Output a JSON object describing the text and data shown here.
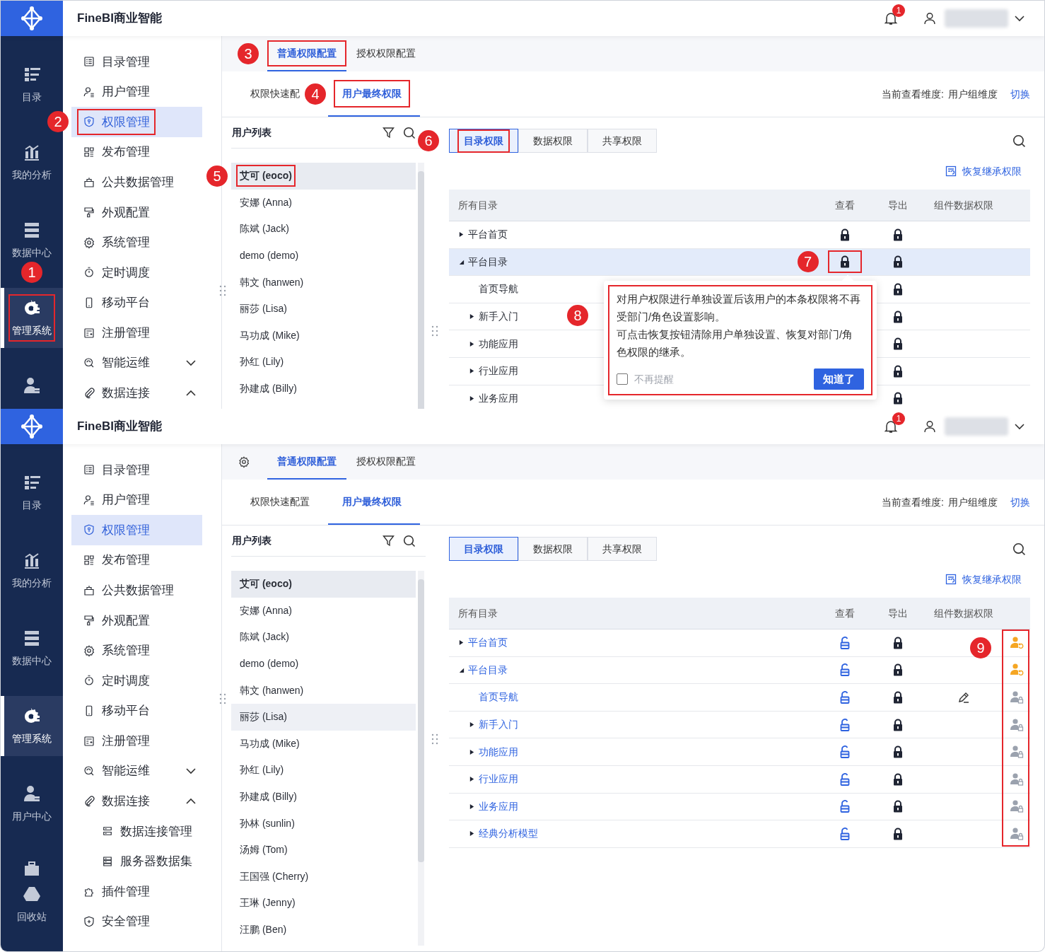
{
  "screens": [
    {
      "app_title": "FineBI商业智能",
      "notification_count": "1",
      "nav": [
        {
          "label": "目录",
          "selected": false
        },
        {
          "label": "我的分析",
          "selected": false
        },
        {
          "label": "数据中心",
          "selected": false
        },
        {
          "label": "管理系统",
          "selected": true,
          "outlined": true,
          "callout": "1"
        },
        {
          "selected": false
        }
      ],
      "menu": [
        {
          "label": "目录管理",
          "selected": false
        },
        {
          "label": "用户管理",
          "selected": false
        },
        {
          "label": "权限管理",
          "selected": true,
          "outlined": true,
          "callout": "2"
        },
        {
          "label": "发布管理",
          "selected": false
        },
        {
          "label": "公共数据管理",
          "selected": false
        },
        {
          "label": "外观配置",
          "selected": false
        },
        {
          "label": "系统管理",
          "selected": false
        },
        {
          "label": "定时调度",
          "selected": false
        },
        {
          "label": "移动平台",
          "selected": false
        },
        {
          "label": "注册管理",
          "selected": false
        },
        {
          "label": "智能运维",
          "selected": false,
          "expanded": false
        },
        {
          "label": "数据连接",
          "selected": false,
          "expanded": true
        }
      ],
      "settings_button": false,
      "top_tabs": [
        {
          "label": "普通权限配置",
          "selected": true,
          "outlined": true,
          "callout": "3"
        },
        {
          "label": "授权权限配置",
          "selected": false
        }
      ],
      "sub_tabs": [
        {
          "label": "权限快速配",
          "selected": false
        },
        {
          "label": "用户最终权限",
          "selected": true,
          "outlined": true,
          "callout": "4"
        }
      ],
      "dimension": {
        "label": "当前查看维度:",
        "value": "用户组维度",
        "link": "切换"
      },
      "user_list": {
        "title": "用户列表",
        "users": [
          {
            "name": "艾可 (eoco)",
            "selected": true,
            "hovered": false,
            "outlined": true,
            "callout": "5"
          },
          {
            "name": "安娜 (Anna)",
            "selected": false,
            "hovered": false
          },
          {
            "name": "陈斌 (Jack)",
            "selected": false,
            "hovered": false
          },
          {
            "name": "demo (demo)",
            "selected": false,
            "hovered": false
          },
          {
            "name": "韩文 (hanwen)",
            "selected": false,
            "hovered": false
          },
          {
            "name": "丽莎 (Lisa)",
            "selected": false,
            "hovered": false
          },
          {
            "name": "马功成 (Mike)",
            "selected": false,
            "hovered": false
          },
          {
            "name": "孙红 (Lily)",
            "selected": false,
            "hovered": false
          },
          {
            "name": "孙建成 (Billy)",
            "selected": false,
            "hovered": false
          }
        ]
      },
      "perm_tabs": [
        {
          "label": "目录权限",
          "selected": true,
          "outlined": true,
          "callout": "6"
        },
        {
          "label": "数据权限",
          "selected": false
        },
        {
          "label": "共享权限",
          "selected": false
        }
      ],
      "restore_link": "恢复继承权限",
      "table": {
        "columns": [
          "所有目录",
          "查看",
          "导出",
          "组件数据权限"
        ],
        "rows": [
          {
            "name": "平台首页",
            "expanded": false,
            "selected": false,
            "modified": false,
            "view_locked": true,
            "export_locked": true
          },
          {
            "name": "平台目录",
            "expanded": true,
            "selected": true,
            "modified": false,
            "view_locked": true,
            "view_outlined": true,
            "view_callout": "7",
            "export_locked": true,
            "children": [
              {
                "name": "首页导航",
                "selected": false,
                "modified": false,
                "export_locked": true
              },
              {
                "name": "新手入门",
                "expanded": false,
                "selected": false,
                "modified": false,
                "export_locked": true
              },
              {
                "name": "功能应用",
                "expanded": false,
                "selected": false,
                "modified": false,
                "export_locked": true
              },
              {
                "name": "行业应用",
                "expanded": false,
                "selected": false,
                "modified": false,
                "export_locked": true
              },
              {
                "name": "业务应用",
                "expanded": false,
                "selected": false,
                "modified": false,
                "export_locked": true
              }
            ]
          }
        ]
      },
      "popover": {
        "paragraphs": [
          "对用户权限进行单独设置后该用户的本条权限将不再受部门/角色设置影响。",
          "可点击恢复按钮清除用户单独设置、恢复对部门/角色权限的继承。"
        ],
        "checkbox": {
          "label": "不再提醒",
          "checked": false
        },
        "button": "知道了",
        "outlined": true,
        "callout": "8"
      }
    },
    {
      "app_title": "FineBI商业智能",
      "notification_count": "1",
      "nav": [
        {
          "label": "目录",
          "selected": false
        },
        {
          "label": "我的分析",
          "selected": false
        },
        {
          "label": "数据中心",
          "selected": false
        },
        {
          "label": "管理系统",
          "selected": true
        },
        {
          "label": "用户中心",
          "selected": false
        },
        {
          "label": "回收站",
          "selected": false
        }
      ],
      "menu": [
        {
          "label": "目录管理",
          "selected": false
        },
        {
          "label": "用户管理",
          "selected": false
        },
        {
          "label": "权限管理",
          "selected": true
        },
        {
          "label": "发布管理",
          "selected": false
        },
        {
          "label": "公共数据管理",
          "selected": false
        },
        {
          "label": "外观配置",
          "selected": false
        },
        {
          "label": "系统管理",
          "selected": false
        },
        {
          "label": "定时调度",
          "selected": false
        },
        {
          "label": "移动平台",
          "selected": false
        },
        {
          "label": "注册管理",
          "selected": false
        },
        {
          "label": "智能运维",
          "selected": false,
          "expanded": false
        },
        {
          "label": "数据连接",
          "selected": false,
          "expanded": true,
          "children": [
            {
              "label": "数据连接管理",
              "selected": false
            },
            {
              "label": "服务器数据集",
              "selected": false
            }
          ]
        },
        {
          "label": "插件管理",
          "selected": false
        },
        {
          "label": "安全管理",
          "selected": false
        }
      ],
      "settings_button": true,
      "top_tabs": [
        {
          "label": "普通权限配置",
          "selected": true
        },
        {
          "label": "授权权限配置",
          "selected": false
        }
      ],
      "sub_tabs": [
        {
          "label": "权限快速配置",
          "selected": false
        },
        {
          "label": "用户最终权限",
          "selected": true
        }
      ],
      "dimension": {
        "label": "当前查看维度:",
        "value": "用户组维度",
        "link": "切换"
      },
      "user_list": {
        "title": "用户列表",
        "users": [
          {
            "name": "艾可 (eoco)",
            "selected": true,
            "hovered": false
          },
          {
            "name": "安娜 (Anna)",
            "selected": false,
            "hovered": false
          },
          {
            "name": "陈斌 (Jack)",
            "selected": false,
            "hovered": false
          },
          {
            "name": "demo (demo)",
            "selected": false,
            "hovered": false
          },
          {
            "name": "韩文 (hanwen)",
            "selected": false,
            "hovered": false
          },
          {
            "name": "丽莎 (Lisa)",
            "selected": false,
            "hovered": true
          },
          {
            "name": "马功成 (Mike)",
            "selected": false,
            "hovered": false
          },
          {
            "name": "孙红 (Lily)",
            "selected": false,
            "hovered": false
          },
          {
            "name": "孙建成 (Billy)",
            "selected": false,
            "hovered": false
          },
          {
            "name": "孙林 (sunlin)",
            "selected": false,
            "hovered": false
          },
          {
            "name": "汤姆 (Tom)",
            "selected": false,
            "hovered": false
          },
          {
            "name": "王国强 (Cherry)",
            "selected": false,
            "hovered": false
          },
          {
            "name": "王琳 (Jenny)",
            "selected": false,
            "hovered": false
          },
          {
            "name": "汪鹏 (Ben)",
            "selected": false,
            "hovered": false
          }
        ]
      },
      "perm_tabs": [
        {
          "label": "目录权限",
          "selected": true
        },
        {
          "label": "数据权限",
          "selected": false
        },
        {
          "label": "共享权限",
          "selected": false
        }
      ],
      "restore_link": "恢复继承权限",
      "table": {
        "columns": [
          "所有目录",
          "查看",
          "导出",
          "组件数据权限"
        ],
        "status_outlined": true,
        "status_callout": "9",
        "rows": [
          {
            "name": "平台首页",
            "expanded": false,
            "selected": false,
            "modified": true,
            "view_locked": false,
            "export_locked": true,
            "inheritance_overridden": true
          },
          {
            "name": "平台目录",
            "expanded": true,
            "selected": false,
            "modified": true,
            "view_locked": false,
            "export_locked": true,
            "inheritance_overridden": true,
            "children": [
              {
                "name": "首页导航",
                "selected": false,
                "modified": true,
                "view_locked": false,
                "export_locked": true,
                "component_edit": true,
                "inheritance_overridden": false
              },
              {
                "name": "新手入门",
                "expanded": false,
                "selected": false,
                "modified": true,
                "view_locked": false,
                "export_locked": true,
                "inheritance_overridden": false
              },
              {
                "name": "功能应用",
                "expanded": false,
                "selected": false,
                "modified": true,
                "view_locked": false,
                "export_locked": true,
                "inheritance_overridden": false
              },
              {
                "name": "行业应用",
                "expanded": false,
                "selected": false,
                "modified": true,
                "view_locked": false,
                "export_locked": true,
                "inheritance_overridden": false
              },
              {
                "name": "业务应用",
                "expanded": false,
                "selected": false,
                "modified": true,
                "view_locked": false,
                "export_locked": true,
                "inheritance_overridden": false
              },
              {
                "name": "经典分析模型",
                "expanded": false,
                "selected": false,
                "modified": true,
                "view_locked": false,
                "export_locked": true,
                "inheritance_overridden": false
              }
            ]
          }
        ]
      }
    }
  ]
}
